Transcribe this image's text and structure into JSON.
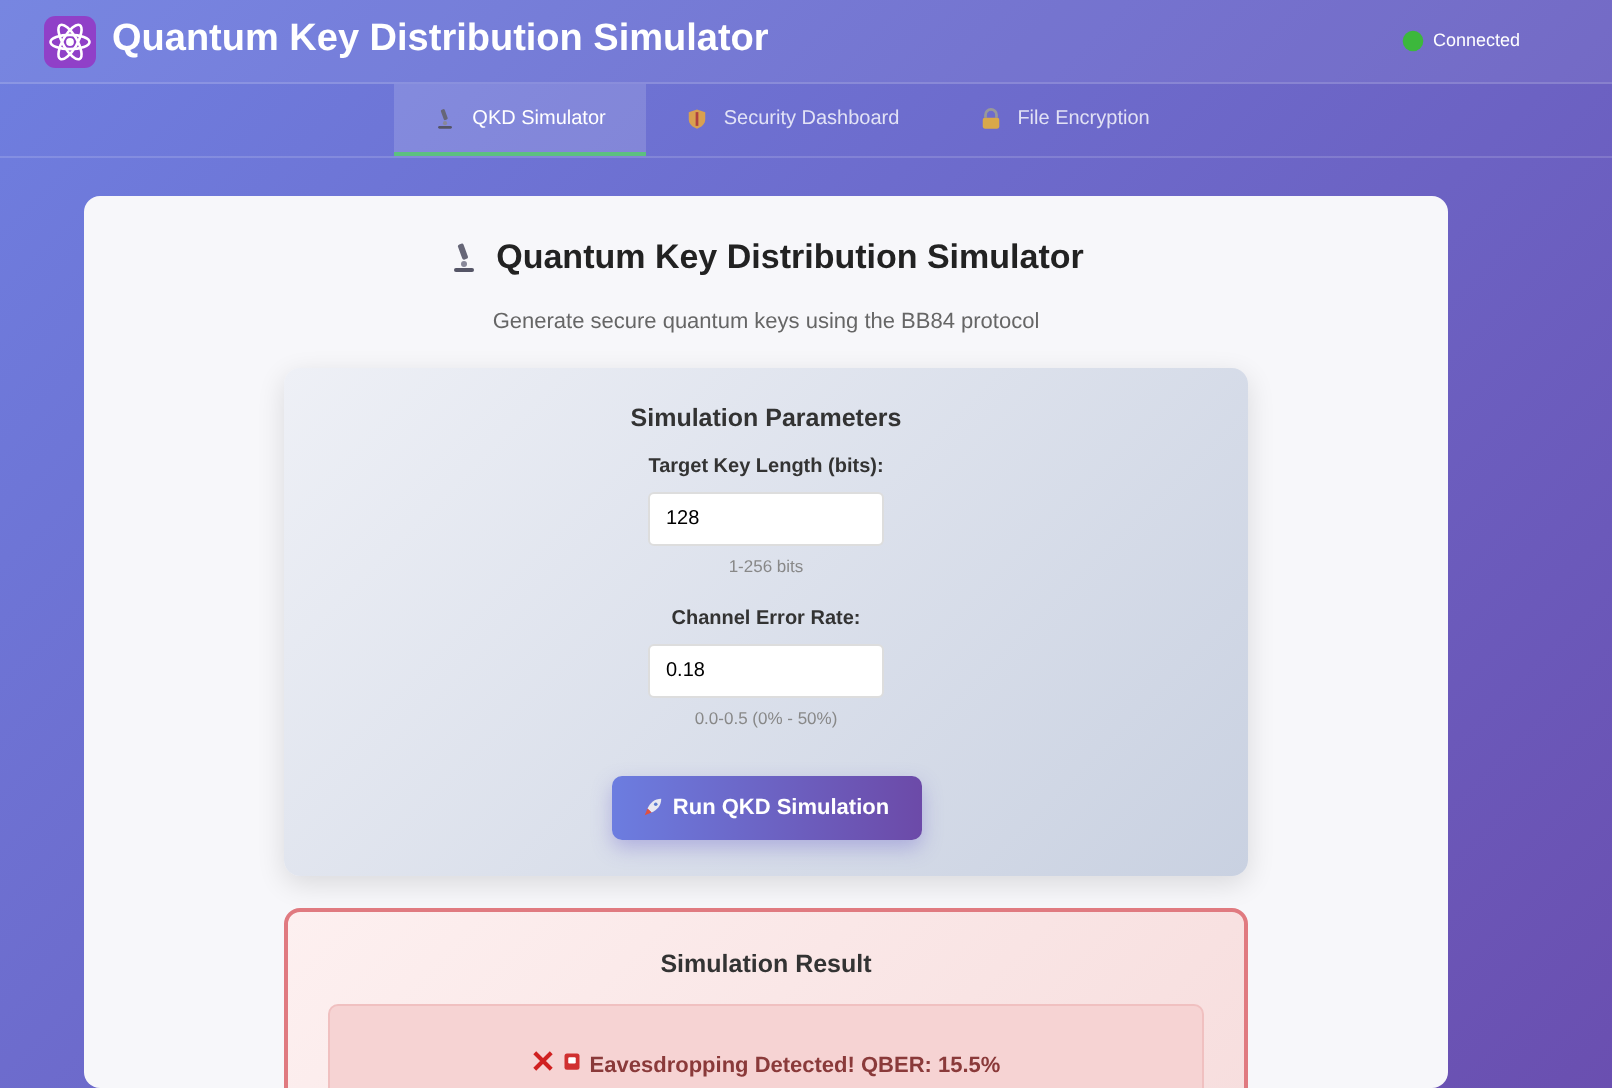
{
  "header": {
    "title": "Quantum Key Distribution Simulator",
    "status": {
      "label": "Connected",
      "connected": true
    }
  },
  "tabs": [
    {
      "label": "QKD Simulator",
      "selected": true
    },
    {
      "label": "Security Dashboard",
      "selected": false
    },
    {
      "label": "File Encryption",
      "selected": false
    }
  ],
  "main": {
    "title": "Quantum Key Distribution Simulator",
    "subtitle": "Generate secure quantum keys using the BB84 protocol"
  },
  "parameters": {
    "title": "Simulation Parameters",
    "fields": [
      {
        "label": "Target Key Length (bits):",
        "value": "128",
        "hint": "1-256 bits"
      },
      {
        "label": "Channel Error Rate:",
        "value": "0.18",
        "hint": "0.0-0.5 (0% - 50%)"
      }
    ],
    "button": "Run QKD Simulation"
  },
  "result": {
    "title": "Simulation Result",
    "secure": false,
    "message": "Eavesdropping Detected! QBER: 15.5%"
  }
}
